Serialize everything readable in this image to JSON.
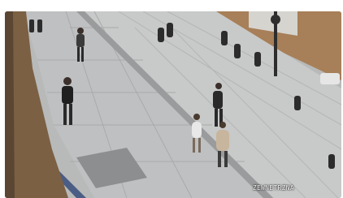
{
  "watermark": {
    "text": "ZEWNETRZNA"
  }
}
